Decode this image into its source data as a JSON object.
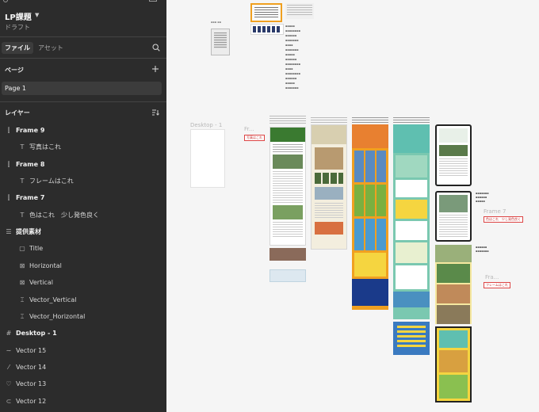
{
  "file": {
    "name": "LP課題",
    "status": "ドラフト"
  },
  "tabs": {
    "file": "ファイル",
    "assets": "アセット"
  },
  "pages": {
    "label": "ページ",
    "items": [
      "Page 1"
    ]
  },
  "layers": {
    "label": "レイヤー",
    "items": [
      {
        "name": "Frame 9",
        "icon": "frame-icon",
        "bold": true
      },
      {
        "name": "写真はこれ",
        "icon": "text-icon",
        "bold": false
      },
      {
        "name": "Frame 8",
        "icon": "frame-icon",
        "bold": true
      },
      {
        "name": "フレームはこれ",
        "icon": "text-icon",
        "bold": false
      },
      {
        "name": "Frame 7",
        "icon": "frame-icon",
        "bold": true
      },
      {
        "name": "色はこれ　少し発色良く",
        "icon": "text-icon",
        "bold": false
      },
      {
        "name": "提供素材",
        "icon": "group-icon",
        "bold": true
      },
      {
        "name": "Title",
        "icon": "rectangle-icon",
        "bold": false
      },
      {
        "name": "Horizontal",
        "icon": "image-icon",
        "bold": false
      },
      {
        "name": "Vertical",
        "icon": "image-icon",
        "bold": false
      },
      {
        "name": "Vector_Vertical",
        "icon": "vector-group-icon",
        "bold": false
      },
      {
        "name": "Vector_Horizontal",
        "icon": "vector-group-icon",
        "bold": false
      },
      {
        "name": "Desktop - 1",
        "icon": "hash-frame-icon",
        "bold": true
      },
      {
        "name": "Vector 15",
        "icon": "vector-icon",
        "bold": false
      },
      {
        "name": "Vector 14",
        "icon": "vector-icon",
        "bold": false
      },
      {
        "name": "Vector 13",
        "icon": "vector-icon",
        "bold": false
      },
      {
        "name": "Vector 12",
        "icon": "vector-icon",
        "bold": false
      }
    ]
  },
  "canvas": {
    "desktop_label": "Desktop - 1",
    "fr_label": "Fr...",
    "frame7_label": "Frame 7",
    "fra_label": "Fra...",
    "tag_photo": "写真はこれ",
    "tag_color": "色はこれ　少し発色良く",
    "tag_frame": "フレームはこれ"
  },
  "colors": {
    "sidebar_bg": "#2c2c2c",
    "canvas_bg": "#f5f5f5",
    "accent_orange": "#f0a020",
    "teal": "#5fbfb0",
    "yellow": "#f5d540",
    "navy": "#1a3a8a",
    "green": "#3a7a30"
  }
}
